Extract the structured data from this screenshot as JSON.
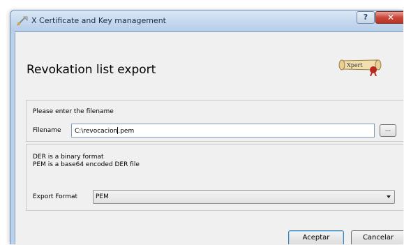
{
  "window": {
    "title": "X Certificate and Key management",
    "help_label": "?",
    "close_label": "✕"
  },
  "dialog": {
    "heading": "Revokation list export",
    "logo_text": "Xpert"
  },
  "filename_group": {
    "prompt": "Please enter the filename",
    "label": "Filename",
    "value_before_caret": "C:\\revocacion",
    "value_after_caret": ".pem",
    "browse_label": "..."
  },
  "format_group": {
    "info_line1": "DER is a binary format",
    "info_line2": "PEM is a base64 encoded DER file",
    "label": "Export Format",
    "selected": "PEM"
  },
  "buttons": {
    "ok": "Aceptar",
    "cancel": "Cancelar"
  },
  "colors": {
    "titlebar": "#c4d8ee",
    "close": "#c9483a",
    "dialog_bg": "#f0f0f0",
    "default_button_border": "#3c7fb1"
  }
}
